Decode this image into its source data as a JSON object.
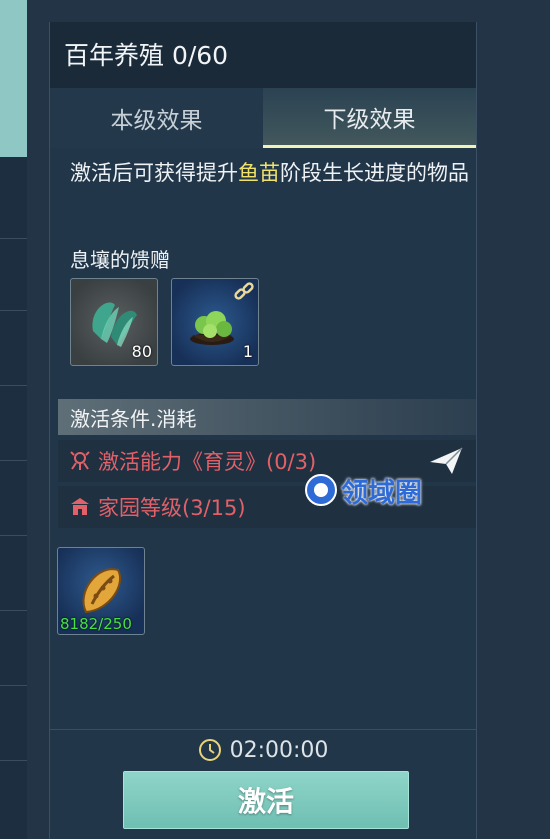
{
  "panel": {
    "title": "百年养殖 0/60",
    "tabs": [
      {
        "label": "本级效果",
        "active": false
      },
      {
        "label": "下级效果",
        "active": true
      }
    ]
  },
  "description": {
    "prefix": "激活后可获得提升",
    "highlight": "鱼苗",
    "suffix": "阶段生长进度的物品",
    "highlight_color": "#f1e26a"
  },
  "rewards": {
    "label": "息壤的馈赠",
    "items": [
      {
        "icon": "green-leaf-crystal-icon",
        "count": "80"
      },
      {
        "icon": "herb-bowl-icon",
        "count": "1",
        "linked": true
      }
    ]
  },
  "conditions": {
    "header": "激活条件.消耗",
    "rows": [
      {
        "icon": "skill-icon",
        "text": "激活能力《育灵》(0/3)",
        "color": "#e26068"
      },
      {
        "icon": "house-icon",
        "text": "家园等级(3/15)",
        "color": "#e26068"
      }
    ],
    "send_icon": "paper-plane-icon"
  },
  "material": {
    "icon": "golden-seed-icon",
    "count": "8182/250",
    "count_color": "#47e045"
  },
  "timer": {
    "value": "02:00:00"
  },
  "activate_button": {
    "label": "激活"
  },
  "watermark": {
    "text": "领域圈"
  }
}
